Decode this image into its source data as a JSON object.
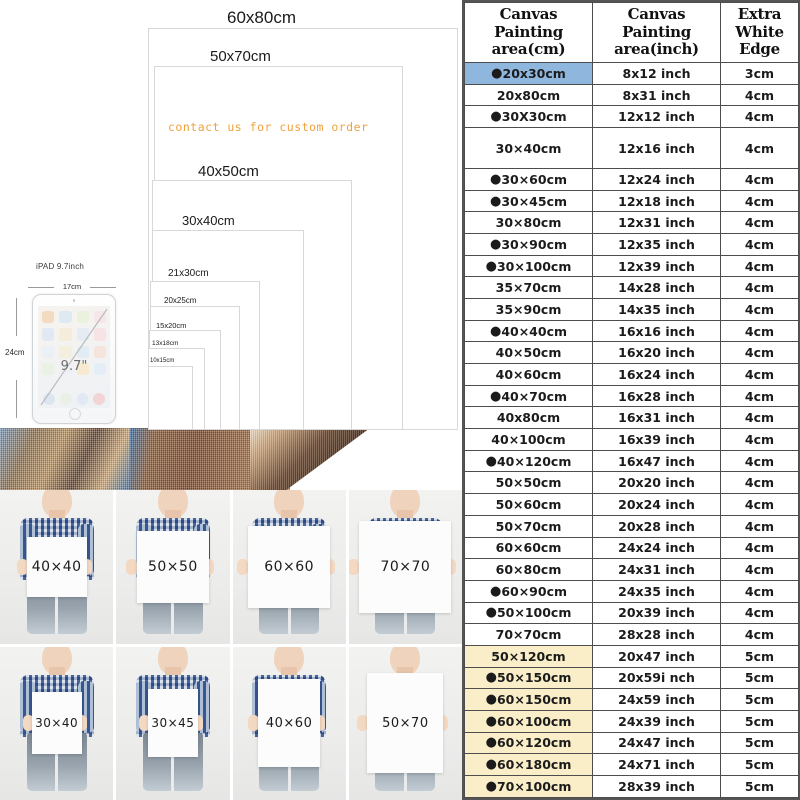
{
  "left_panel": {
    "size_diagram": {
      "rectangles": [
        {
          "label": "60x80cm",
          "size_class": "r1"
        },
        {
          "label": "50x70cm",
          "size_class": "r2"
        },
        {
          "label": "40x50cm",
          "size_class": "r3"
        },
        {
          "label": "30x40cm",
          "size_class": "r4"
        },
        {
          "label": "21x30cm",
          "size_class": "r5"
        },
        {
          "label": "20x25cm",
          "size_class": "r6"
        },
        {
          "label": "15x20cm",
          "size_class": "r7"
        },
        {
          "label": "13x18cm",
          "size_class": "r8"
        },
        {
          "label": "10x15cm",
          "size_class": "r9"
        }
      ],
      "custom_note": "contact us for  custom  order"
    },
    "ipad": {
      "title": "iPAD 9.7inch",
      "width_label": "17cm",
      "height_label": "24cm",
      "diagonal_label": "9.7\""
    },
    "photo_grid": {
      "row1": [
        "40×40",
        "50×50",
        "60×60",
        "70×70"
      ],
      "row2": [
        "30×40",
        "30×45",
        "40×60",
        "50×70"
      ]
    }
  },
  "table": {
    "headers": [
      "Canvas Painting area(cm)",
      "Canvas Painting area(inch)",
      "Extra White Edge"
    ],
    "header_lines": [
      [
        "Canvas",
        "Painting",
        "area(cm)"
      ],
      [
        "Canvas",
        "Painting",
        "area(inch)"
      ],
      [
        "Extra",
        "White",
        "Edge"
      ]
    ],
    "rows": [
      {
        "cm": "20x30cm",
        "inch": "8x12 inch",
        "edge": "3cm",
        "dot": true,
        "hl": "blue"
      },
      {
        "cm": "20x80cm",
        "inch": "8x31 inch",
        "edge": "4cm",
        "dot": false,
        "hl": ""
      },
      {
        "cm": "30X30cm",
        "inch": "12x12 inch",
        "edge": "4cm",
        "dot": true,
        "hl": ""
      },
      {
        "cm": "30×40cm",
        "inch": "12x16 inch",
        "edge": "4cm",
        "dot": false,
        "hl": "",
        "tall": true
      },
      {
        "cm": "30×60cm",
        "inch": "12x24 inch",
        "edge": "4cm",
        "dot": true,
        "hl": ""
      },
      {
        "cm": "30×45cm",
        "inch": "12x18 inch",
        "edge": "4cm",
        "dot": true,
        "hl": ""
      },
      {
        "cm": "30×80cm",
        "inch": "12x31 inch",
        "edge": "4cm",
        "dot": false,
        "hl": ""
      },
      {
        "cm": "30×90cm",
        "inch": "12x35 inch",
        "edge": "4cm",
        "dot": true,
        "hl": ""
      },
      {
        "cm": "30×100cm",
        "inch": "12x39 inch",
        "edge": "4cm",
        "dot": true,
        "hl": ""
      },
      {
        "cm": "35×70cm",
        "inch": "14x28 inch",
        "edge": "4cm",
        "dot": false,
        "hl": ""
      },
      {
        "cm": "35×90cm",
        "inch": "14x35 inch",
        "edge": "4cm",
        "dot": false,
        "hl": ""
      },
      {
        "cm": "40×40cm",
        "inch": "16x16 inch",
        "edge": "4cm",
        "dot": true,
        "hl": ""
      },
      {
        "cm": "40×50cm",
        "inch": "16x20 inch",
        "edge": "4cm",
        "dot": false,
        "hl": ""
      },
      {
        "cm": "40×60cm",
        "inch": "16x24 inch",
        "edge": "4cm",
        "dot": false,
        "hl": ""
      },
      {
        "cm": "40×70cm",
        "inch": "16x28 inch",
        "edge": "4cm",
        "dot": true,
        "hl": ""
      },
      {
        "cm": "40x80cm",
        "inch": "16x31 inch",
        "edge": "4cm",
        "dot": false,
        "hl": ""
      },
      {
        "cm": "40×100cm",
        "inch": "16x39 inch",
        "edge": "4cm",
        "dot": false,
        "hl": ""
      },
      {
        "cm": "40×120cm",
        "inch": "16x47 inch",
        "edge": "4cm",
        "dot": true,
        "hl": ""
      },
      {
        "cm": "50×50cm",
        "inch": "20x20 inch",
        "edge": "4cm",
        "dot": false,
        "hl": ""
      },
      {
        "cm": "50×60cm",
        "inch": "20x24 inch",
        "edge": "4cm",
        "dot": false,
        "hl": ""
      },
      {
        "cm": "50×70cm",
        "inch": "20x28 inch",
        "edge": "4cm",
        "dot": false,
        "hl": ""
      },
      {
        "cm": "60×60cm",
        "inch": "24x24 inch",
        "edge": "4cm",
        "dot": false,
        "hl": ""
      },
      {
        "cm": "60×80cm",
        "inch": "24x31 inch",
        "edge": "4cm",
        "dot": false,
        "hl": ""
      },
      {
        "cm": "60×90cm",
        "inch": "24x35 inch",
        "edge": "4cm",
        "dot": true,
        "hl": ""
      },
      {
        "cm": "50×100cm",
        "inch": "20x39 inch",
        "edge": "4cm",
        "dot": true,
        "hl": ""
      },
      {
        "cm": "70×70cm",
        "inch": "28x28 inch",
        "edge": "4cm",
        "dot": false,
        "hl": ""
      },
      {
        "cm": "50×120cm",
        "inch": "20x47 inch",
        "edge": "5cm",
        "dot": false,
        "hl": "cream"
      },
      {
        "cm": "50×150cm",
        "inch": "20x59i nch",
        "edge": "5cm",
        "dot": true,
        "hl": "cream"
      },
      {
        "cm": "60×150cm",
        "inch": "24x59 inch",
        "edge": "5cm",
        "dot": true,
        "hl": "cream"
      },
      {
        "cm": "60×100cm",
        "inch": "24x39 inch",
        "edge": "5cm",
        "dot": true,
        "hl": "cream"
      },
      {
        "cm": "60×120cm",
        "inch": "24x47 inch",
        "edge": "5cm",
        "dot": true,
        "hl": "cream"
      },
      {
        "cm": "60×180cm",
        "inch": "24x71 inch",
        "edge": "5cm",
        "dot": true,
        "hl": "cream"
      },
      {
        "cm": "70×100cm",
        "inch": "28x39 inch",
        "edge": "5cm",
        "dot": true,
        "hl": "cream"
      }
    ]
  },
  "colors": {
    "highlight_blue": "#8fb7de",
    "highlight_cream": "#faeec9",
    "note_orange": "#f0a13c",
    "table_border": "#4d4d4d"
  }
}
